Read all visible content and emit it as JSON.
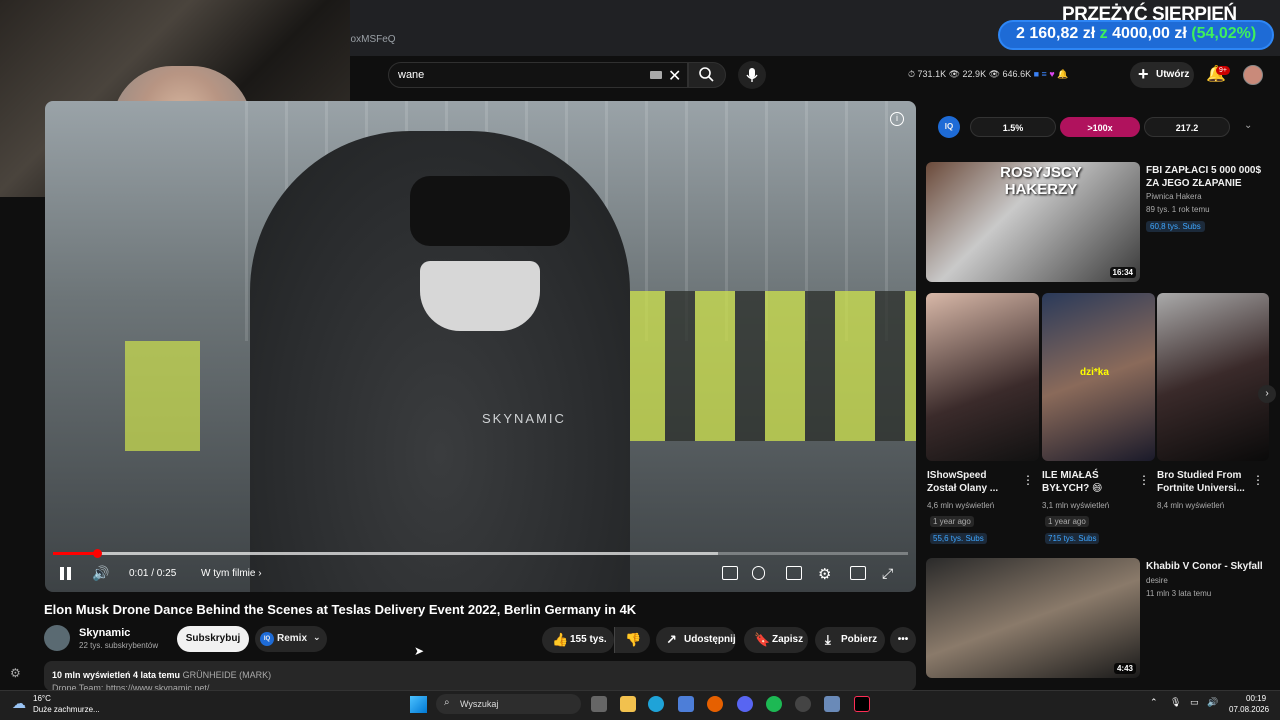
{
  "browser": {
    "address_fragment": "uoxMSFeQ"
  },
  "overlay": {
    "title": "PRZEŻYĆ SIERPIEŃ",
    "amount": "2 160,82 zł",
    "z": "z",
    "target": "4000,00 zł",
    "percent": "(54,02%)"
  },
  "header": {
    "search_value": "wane",
    "stat1": "731.1K",
    "stat2": "22.9K",
    "stat3": "646.6K",
    "create_label": "Utwórz",
    "notif_badge": "9+"
  },
  "player": {
    "time": "0:01 / 0:25",
    "chapter": "W tym filmie",
    "video_logo": "SKYNAMIC",
    "progress_percent": 5
  },
  "video": {
    "title": "Elon Musk Drone Dance Behind the Scenes at Teslas Delivery Event 2022, Berlin Germany in 4K",
    "channel": "Skynamic",
    "subs": "22 tys. subskrybentów",
    "subscribe": "Subskrybuj",
    "remix": "Remix",
    "likes": "155 tys.",
    "share": "Udostępnij",
    "save": "Zapisz",
    "download": "Pobierz",
    "desc_views": "10 mln wyświetleń  4 lata temu",
    "desc_location": "GRÜNHEIDE (MARK)",
    "desc_line2": "Drone Team: https://www.skynamic.net/"
  },
  "iq": {
    "logo": "IQ",
    "v1": "1.5%",
    "v2": ">100x",
    "v3": "217.2"
  },
  "recommended": [
    {
      "title": "FBI ZAPŁACI 5 000 000$ ZA JEGO ZŁAPANIE",
      "channel": "Piwnica Hakera",
      "meta": "89 tys.   1 rok temu",
      "subs": "60,8 tys. Subs",
      "thumb_text": "ROSYJSCY HAKERZY",
      "duration": "16:34"
    },
    {
      "title": "Khabib V Conor - Skyfall",
      "channel": "desire",
      "meta": "11 mln   3 lata temu",
      "duration": "4:43"
    }
  ],
  "shorts": [
    {
      "title": "IShowSpeed Został Olany ...",
      "views": "4,6 mln wyświetleń",
      "date": "1 year ago",
      "subs": "55,6 tys. Subs"
    },
    {
      "title": "ILE MIAŁAŚ BYŁYCH? 😄",
      "views": "3,1 mln wyświetleń",
      "date": "1 year ago",
      "subs": "715 tys. Subs",
      "thumb_text": "dzi*ka"
    },
    {
      "title": "Bro Studied From Fortnite Universi...",
      "views": "8,4 mln wyświetleń"
    }
  ],
  "taskbar": {
    "temp": "16°C",
    "weather": "Duże zachmurze...",
    "search": "Wyszukaj",
    "time": "00:19",
    "date": "07.08.2026"
  }
}
